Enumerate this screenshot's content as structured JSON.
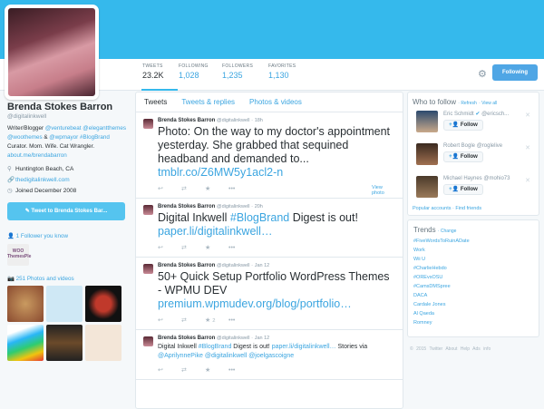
{
  "profile": {
    "name": "Brenda Stokes Barron",
    "handle": "@digitalinkwell",
    "bio": [
      {
        "t": "Writer/Blogger ",
        "l": false
      },
      {
        "t": "@venturebeat",
        "l": true
      },
      {
        "t": " ",
        "l": false
      },
      {
        "t": "@elegantthemes",
        "l": true
      },
      {
        "t": " ",
        "l": false
      },
      {
        "t": "@woothemes",
        "l": true
      },
      {
        "t": " & ",
        "l": false
      },
      {
        "t": "@wpmayor",
        "l": true
      },
      {
        "t": " ",
        "l": false
      },
      {
        "t": "#BlogBrand",
        "l": true
      },
      {
        "t": " Curator. Mom. Wife. Cat Wrangler. ",
        "l": false
      },
      {
        "t": "about.me/brendabarron",
        "l": true
      }
    ],
    "location": "Huntington Beach, CA",
    "website": "thedigitalinkwell.com",
    "joined": "Joined December 2008",
    "tweet_to": "Tweet to Brenda Stokes Bar...",
    "followers_you_know": "1 Follower you know",
    "woo_label": "WOO ThemesPle",
    "photos": "251 Photos and videos"
  },
  "stats": [
    {
      "label": "TWEETS",
      "value": "23.2K"
    },
    {
      "label": "FOLLOWING",
      "value": "1,028"
    },
    {
      "label": "FOLLOWERS",
      "value": "1,235"
    },
    {
      "label": "FAVORITES",
      "value": "1,130"
    }
  ],
  "following_btn": "Following",
  "tabs": [
    "Tweets",
    "Tweets & replies",
    "Photos & videos"
  ],
  "tweets": [
    {
      "name": "Brenda Stokes Barron",
      "handle": "@digitalinkwell",
      "time": "18h",
      "text": "Photo: On the way to my doctor's appointment yesterday. She grabbed that sequined headband and demanded to... ",
      "link": "tmblr.co/Z6MW5y1acl2-n",
      "extra": "View photo",
      "fav": ""
    },
    {
      "name": "Brenda Stokes Barron",
      "handle": "@digitalinkwell",
      "time": "20h",
      "text": "Digital Inkwell ",
      "hash": "#BlogBrand",
      "text2": " Digest is out! ",
      "link": "paper.li/digitalinkwell…",
      "fav": ""
    },
    {
      "name": "Brenda Stokes Barron",
      "handle": "@digitalinkwell",
      "time": "Jan 12",
      "text": "50+ Quick Setup Portfolio WordPress Themes - WPMU DEV ",
      "link": "premium.wpmudev.org/blog/portfolio…",
      "fav": "2"
    },
    {
      "name": "Brenda Stokes Barron",
      "handle": "@digitalinkwell",
      "time": "Jan 12",
      "text": "Digital Inkwell ",
      "hash": "#BlogBrand",
      "text2": " Digest is out! ",
      "link": "paper.li/digitalinkwell…",
      "text3": " Stories via ",
      "mentions": "@AprilynnePike @digitalinkwell @joelgascoigne",
      "fav": ""
    }
  ],
  "who_to_follow": {
    "title": "Who to follow",
    "refresh": "· Refresh",
    "view_all": "· View all",
    "follow_label": "Follow",
    "users": [
      {
        "name": "Eric Schmidt",
        "handle": "@ericsch...",
        "verified": true
      },
      {
        "name": "Robert Bogle",
        "handle": "@roglelive"
      },
      {
        "name": "Michael Haynes",
        "handle": "@mohio73"
      }
    ],
    "popular": "Popular accounts",
    "find": "· Find friends"
  },
  "trends": {
    "title": "Trends",
    "change": "· Change",
    "items": [
      "#FiveWordsToRuinADate",
      "Work",
      "Wii U",
      "#CharlieHebdo",
      "#OREvsOSU",
      "#CamsDMSpree",
      "DACA",
      "Cardale Jones",
      "Al Qaeda",
      "Romney"
    ]
  },
  "footer": "© 2015 Twitter  About  Help  Ads info",
  "colors": {
    "banner": "#35b9ec",
    "link": "#3ba5e0"
  }
}
